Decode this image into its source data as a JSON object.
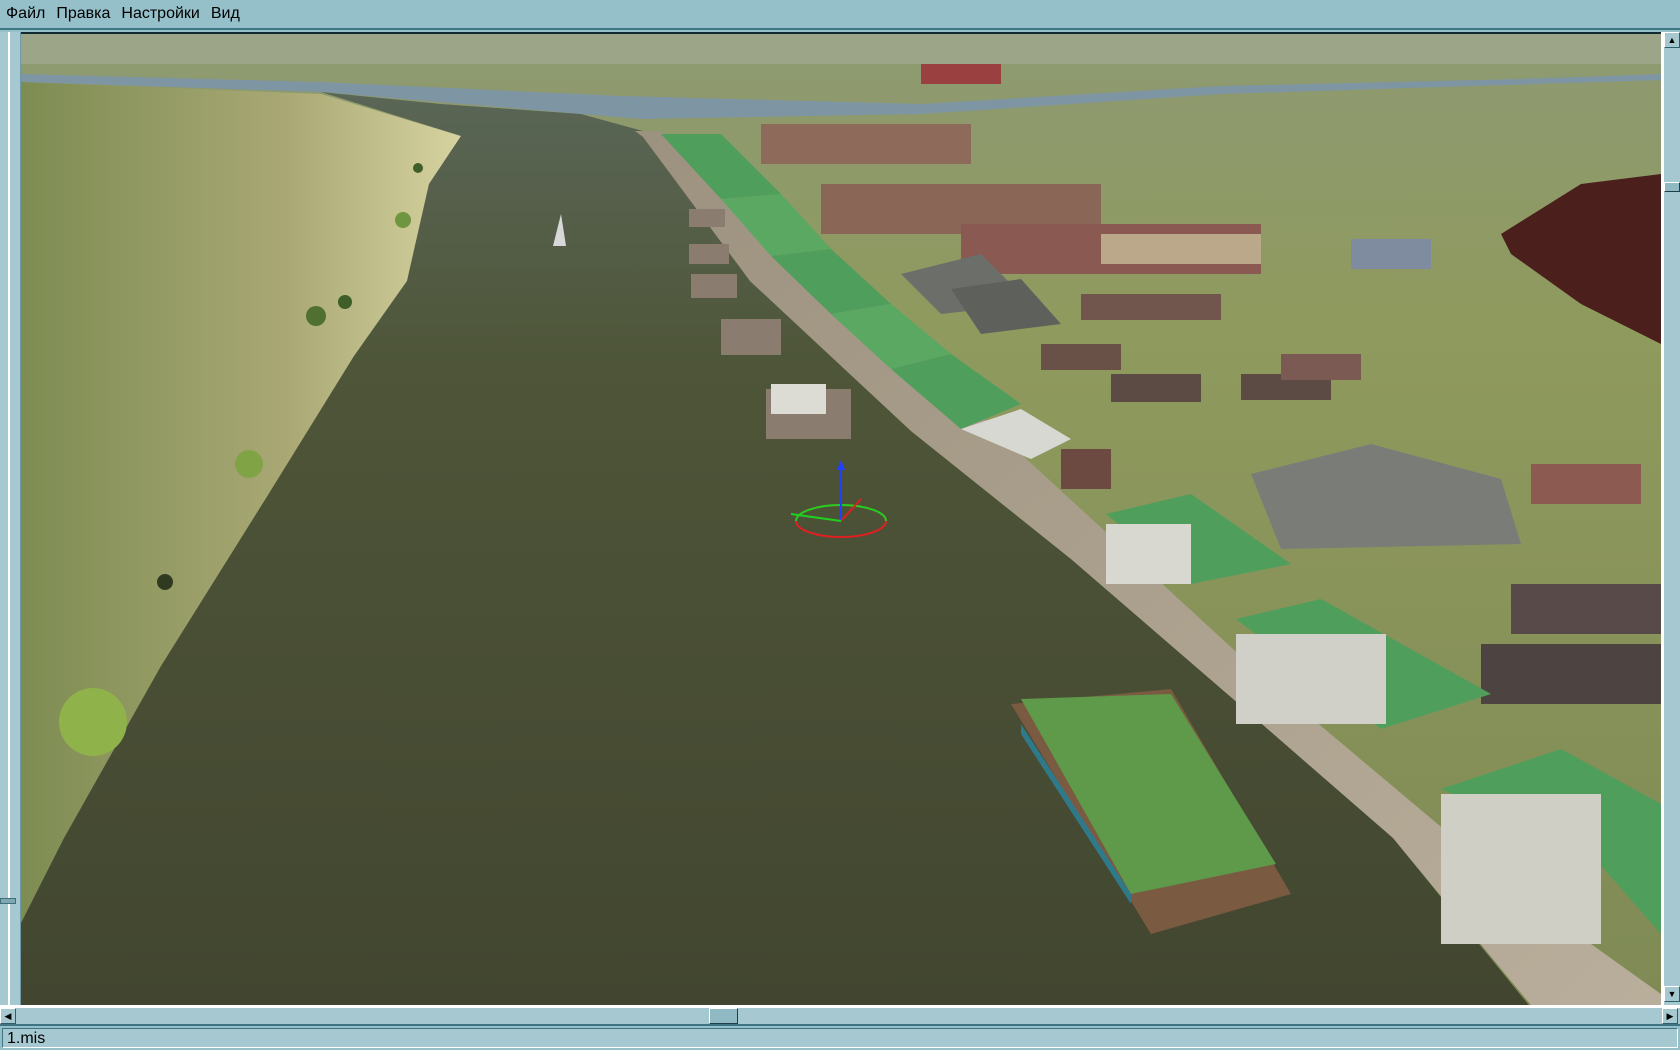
{
  "menu": {
    "items": [
      {
        "label": "Файл"
      },
      {
        "label": "Правка"
      },
      {
        "label": "Настройки"
      },
      {
        "label": "Вид"
      }
    ]
  },
  "viewport": {
    "scene": "3d-mission-view",
    "colors": {
      "water": "#4a4f33",
      "land": "#8c9664",
      "roof": "#4f9e5c",
      "pier": "#b1a795"
    }
  },
  "scrollbars": {
    "up_icon": "arrow-up-icon",
    "down_icon": "arrow-down-icon",
    "left_icon": "arrow-left-icon",
    "right_icon": "arrow-right-icon"
  },
  "status": {
    "filename": "1.mis"
  }
}
